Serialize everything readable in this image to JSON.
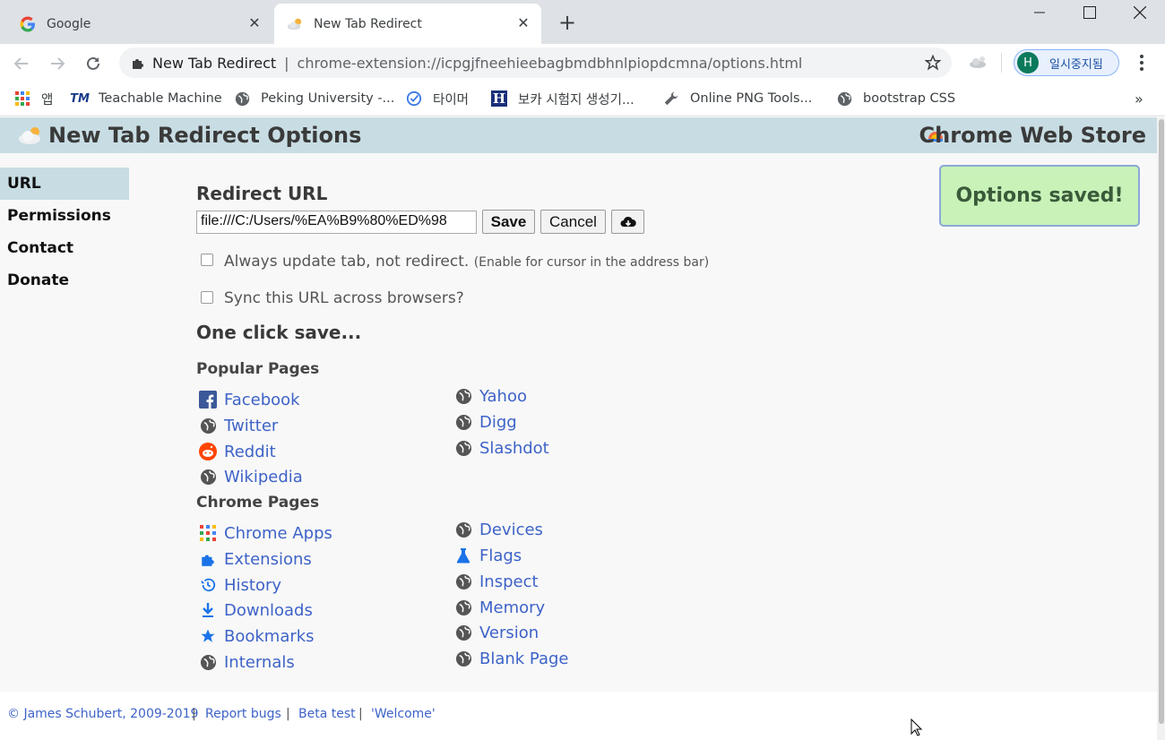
{
  "browser": {
    "tabs": [
      {
        "title": "Google",
        "favicon": "google-g-icon"
      },
      {
        "title": "New Tab Redirect",
        "favicon": "cloud-icon"
      }
    ],
    "omnibox": {
      "site": "New Tab Redirect",
      "separator": "|",
      "url": "chrome-extension://icpgjfneehieebagbmdbhnlpiopdcmna/options.html"
    },
    "profile": {
      "initial": "H",
      "label": "일시중지됨"
    },
    "bookmarks": [
      {
        "label": "앱",
        "icon": "apps-grid-icon"
      },
      {
        "label": "Teachable Machine",
        "icon": "tm-icon"
      },
      {
        "label": "Peking University -...",
        "icon": "globe-icon"
      },
      {
        "label": "타이머",
        "icon": "timer-check-icon"
      },
      {
        "label": "보카 시험지 생성기...",
        "icon": "h-icon"
      },
      {
        "label": "Online PNG Tools...",
        "icon": "wrench-icon"
      },
      {
        "label": "bootstrap CSS",
        "icon": "globe-icon"
      }
    ],
    "bookmarks_overflow": "»"
  },
  "page": {
    "header_title": "New Tab Redirect Options",
    "store_link": "Chrome Web Store",
    "nav": [
      "URL",
      "Permissions",
      "Contact",
      "Donate"
    ],
    "redirect_heading": "Redirect URL",
    "url_value": "file:///C:/Users/%EA%B9%80%ED%98",
    "save_label": "Save",
    "cancel_label": "Cancel",
    "status_message": "Options saved!",
    "option_update_tab": "Always update tab, not redirect.",
    "option_update_tab_note": "(Enable for cursor in the address bar)",
    "option_sync": "Sync this URL across browsers?",
    "one_click_heading": "One click save...",
    "popular_heading": "Popular Pages",
    "popular_left": [
      {
        "label": "Facebook",
        "icon": "facebook-icon"
      },
      {
        "label": "Twitter",
        "icon": "globe-icon"
      },
      {
        "label": "Reddit",
        "icon": "reddit-icon"
      },
      {
        "label": "Wikipedia",
        "icon": "globe-icon"
      }
    ],
    "popular_right": [
      {
        "label": "Yahoo",
        "icon": "globe-icon"
      },
      {
        "label": "Digg",
        "icon": "globe-icon"
      },
      {
        "label": "Slashdot",
        "icon": "globe-icon"
      }
    ],
    "chrome_heading": "Chrome Pages",
    "chrome_left": [
      {
        "label": "Chrome Apps",
        "icon": "apps-grid-icon"
      },
      {
        "label": "Extensions",
        "icon": "puzzle-icon"
      },
      {
        "label": "History",
        "icon": "history-icon"
      },
      {
        "label": "Downloads",
        "icon": "download-icon"
      },
      {
        "label": "Bookmarks",
        "icon": "star-icon"
      },
      {
        "label": "Internals",
        "icon": "globe-icon"
      }
    ],
    "chrome_right": [
      {
        "label": "Devices",
        "icon": "globe-icon"
      },
      {
        "label": "Flags",
        "icon": "flask-icon"
      },
      {
        "label": "Inspect",
        "icon": "globe-icon"
      },
      {
        "label": "Memory",
        "icon": "globe-icon"
      },
      {
        "label": "Version",
        "icon": "globe-icon"
      },
      {
        "label": "Blank Page",
        "icon": "globe-icon"
      }
    ],
    "footer": {
      "copyright": "© James Schubert, 2009-2019",
      "report_bugs": "Report bugs",
      "beta_test": "Beta test",
      "welcome": "'Welcome'",
      "divider": "|"
    }
  },
  "colors": {
    "header_bg": "#c8dde3",
    "link": "#3e63c8",
    "saved_bg": "#c8f2b8"
  }
}
